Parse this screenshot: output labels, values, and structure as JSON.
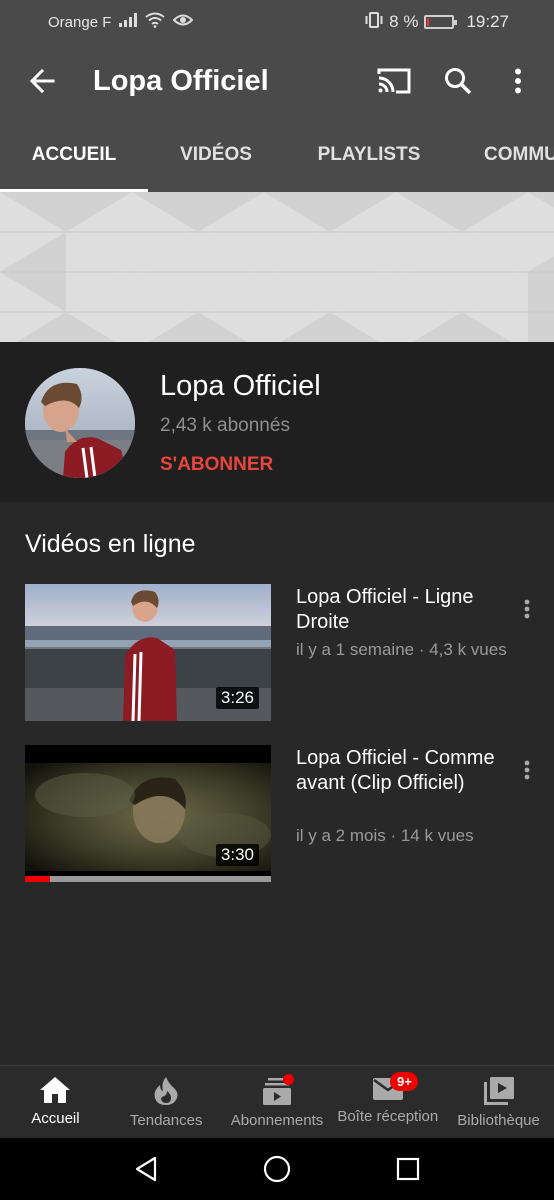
{
  "status_bar": {
    "carrier": "Orange F",
    "battery_percent": "8 %",
    "time": "19:27",
    "battery_level": 0.08
  },
  "app_bar": {
    "title": "Lopa Officiel",
    "icons": [
      "back-arrow-icon",
      "cast-icon",
      "search-icon",
      "more-vertical-icon"
    ]
  },
  "tabs": [
    {
      "label": "ACCUEIL",
      "active": true
    },
    {
      "label": "VIDÉOS",
      "active": false
    },
    {
      "label": "PLAYLISTS",
      "active": false
    },
    {
      "label": "COMMU",
      "active": false
    }
  ],
  "channel": {
    "name": "Lopa Officiel",
    "subscribers": "2,43 k abonnés",
    "subscribe_label": "S'ABONNER"
  },
  "section": {
    "title": "Vidéos en ligne"
  },
  "videos": [
    {
      "title": "Lopa Officiel - Ligne Droite",
      "meta": "il y a 1 semaine · 4,3 k vues",
      "duration": "3:26",
      "watched_fraction": 0
    },
    {
      "title": "Lopa Officiel - Comme avant (Clip Officiel)",
      "meta": "il y a 2 mois · 14 k vues",
      "duration": "3:30",
      "watched_fraction": 0.1
    }
  ],
  "bottom_nav": [
    {
      "label": "Accueil",
      "icon": "home-icon",
      "active": true
    },
    {
      "label": "Tendances",
      "icon": "flame-icon",
      "active": false
    },
    {
      "label": "Abonnements",
      "icon": "subscriptions-icon",
      "active": false
    },
    {
      "label": "Boîte réception",
      "icon": "inbox-icon",
      "badge": "9+",
      "active": false
    },
    {
      "label": "Bibliothèque",
      "icon": "library-icon",
      "active": false
    }
  ],
  "colors": {
    "app_bar": "#4a4a4a",
    "background": "#282828",
    "accent_red": "#e8453c",
    "badge_red": "#e00000"
  }
}
